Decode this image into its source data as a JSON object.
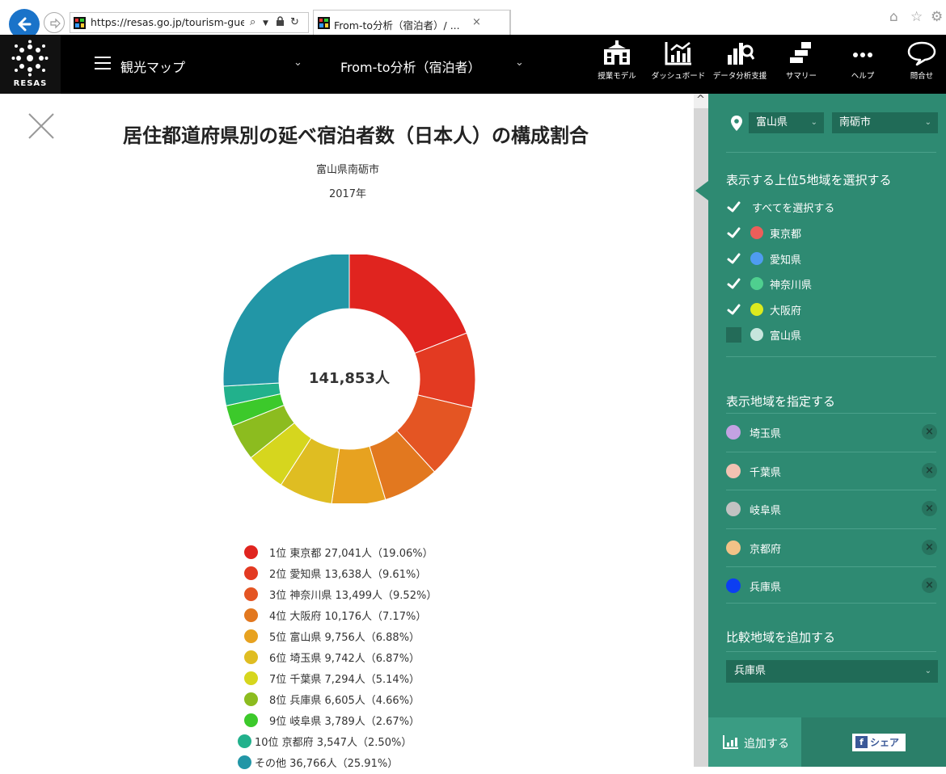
{
  "browser": {
    "url": "https://resas.go.jp/tourism-guest",
    "tab_title": "From-to分析（宿泊者）/ ...",
    "tab_close": "×"
  },
  "app_nav": {
    "logo_text": "RESAS",
    "map_dropdown": "観光マップ",
    "analysis_dropdown": "From-to分析（宿泊者）",
    "items": [
      {
        "label": "授業モデル",
        "icon": "school-icon"
      },
      {
        "label": "ダッシュボード",
        "icon": "dashboard-icon"
      },
      {
        "label": "データ分析支援",
        "icon": "data-analysis-icon"
      },
      {
        "label": "サマリー",
        "icon": "summary-icon"
      },
      {
        "label": "ヘルプ",
        "icon": "help-icon"
      },
      {
        "label": "問合せ",
        "icon": "inquiry-icon"
      }
    ]
  },
  "chart_header": {
    "title": "居住都道府県別の延べ宿泊者数（日本人）の構成割合",
    "region": "富山県南砺市",
    "year": "2017年",
    "total": "141,853人"
  },
  "chart_data": {
    "type": "pie",
    "title": "居住都道府県別の延べ宿泊者数（日本人）の構成割合",
    "subtitle": "富山県南砺市 2017年",
    "center_label": "141,853人",
    "total": 141853,
    "unit": "人",
    "slices": [
      {
        "rank": "1位",
        "name": "東京都",
        "value": 27041,
        "percent": 19.06,
        "label": "1位 東京都 27,041人（19.06%）",
        "color": "#e0241f"
      },
      {
        "rank": "2位",
        "name": "愛知県",
        "value": 13638,
        "percent": 9.61,
        "label": "2位 愛知県 13,638人（9.61%）",
        "color": "#e33a22"
      },
      {
        "rank": "3位",
        "name": "神奈川県",
        "value": 13499,
        "percent": 9.52,
        "label": "3位 神奈川県 13,499人（9.52%）",
        "color": "#e45523"
      },
      {
        "rank": "4位",
        "name": "大阪府",
        "value": 10176,
        "percent": 7.17,
        "label": "4位 大阪府 10,176人（7.17%）",
        "color": "#e2781f"
      },
      {
        "rank": "5位",
        "name": "富山県",
        "value": 9756,
        "percent": 6.88,
        "label": "5位 富山県 9,756人（6.88%）",
        "color": "#e7a220"
      },
      {
        "rank": "6位",
        "name": "埼玉県",
        "value": 9742,
        "percent": 6.87,
        "label": "6位 埼玉県 9,742人（6.87%）",
        "color": "#dfbd22"
      },
      {
        "rank": "7位",
        "name": "千葉県",
        "value": 7294,
        "percent": 5.14,
        "label": "7位 千葉県 7,294人（5.14%）",
        "color": "#d6d61e"
      },
      {
        "rank": "8位",
        "name": "兵庫県",
        "value": 6605,
        "percent": 4.66,
        "label": "8位 兵庫県 6,605人（4.66%）",
        "color": "#8cbc1f"
      },
      {
        "rank": "9位",
        "name": "岐阜県",
        "value": 3789,
        "percent": 2.67,
        "label": "9位 岐阜県 3,789人（2.67%）",
        "color": "#3cc92b"
      },
      {
        "rank": "10位",
        "name": "京都府",
        "value": 3547,
        "percent": 2.5,
        "label": "10位 京都府 3,547人（2.50%）",
        "color": "#22b18c"
      },
      {
        "rank": "",
        "name": "その他",
        "value": 36766,
        "percent": 25.91,
        "label": "その他 36,766人（25.91%）",
        "color": "#2296a6"
      }
    ]
  },
  "side_panel": {
    "prefecture": "富山県",
    "city": "南砺市",
    "top5_heading": "表示する上位5地域を選択する",
    "select_all_label": "すべてを選択する",
    "top5": [
      {
        "name": "東京都",
        "checked": true,
        "color": "#ec5e5a"
      },
      {
        "name": "愛知県",
        "checked": true,
        "color": "#4f9cf0"
      },
      {
        "name": "神奈川県",
        "checked": true,
        "color": "#4fcf8f"
      },
      {
        "name": "大阪府",
        "checked": true,
        "color": "#dcea1e"
      },
      {
        "name": "富山県",
        "checked": false,
        "color": "#c7e6dd"
      }
    ],
    "specified_heading": "表示地域を指定する",
    "specified": [
      {
        "name": "埼玉県",
        "color": "#c3a2e2"
      },
      {
        "name": "千葉県",
        "color": "#f2c2b2"
      },
      {
        "name": "岐阜県",
        "color": "#c2c2c2"
      },
      {
        "name": "京都府",
        "color": "#f2c287"
      },
      {
        "name": "兵庫県",
        "color": "#0c3ef2"
      }
    ],
    "remove_glyph": "×",
    "compare_heading": "比較地域を追加する",
    "compare_value": "兵庫県",
    "add_button": "追加する",
    "share_button": "シェア",
    "share_glyph": "f"
  },
  "colors": {
    "nav_bg": "#000000",
    "panel_bg": "#2e8a72",
    "panel_dark": "#206b57",
    "browser_back": "#1a73c9"
  }
}
